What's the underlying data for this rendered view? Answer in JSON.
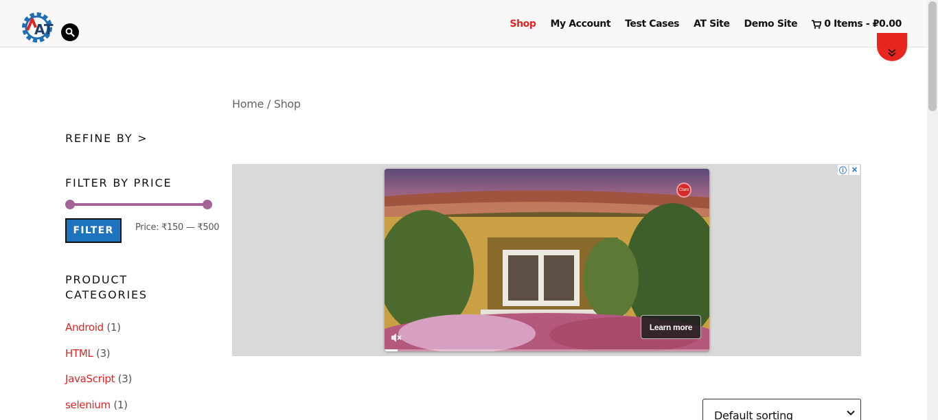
{
  "header": {
    "logo_alt": "AT",
    "nav": [
      {
        "label": "Shop",
        "active": true
      },
      {
        "label": "My Account",
        "active": false
      },
      {
        "label": "Test Cases",
        "active": false
      },
      {
        "label": "AT Site",
        "active": false
      },
      {
        "label": "Demo Site",
        "active": false
      }
    ],
    "cart_label": "0 Items - ₽0.00"
  },
  "breadcrumb": "Home / Shop",
  "sidebar": {
    "refine_title": "REFINE BY >",
    "price_title": "FILTER BY PRICE",
    "filter_button": "FILTER",
    "price_range": "Price: ₹150 — ₹500",
    "price_slider": {
      "min_fraction": 0.0,
      "max_fraction": 1.0
    },
    "categories_title": "PRODUCT CATEGORIES",
    "categories": [
      {
        "name": "Android",
        "count": "(1)"
      },
      {
        "name": "HTML",
        "count": "(3)"
      },
      {
        "name": "JavaScript",
        "count": "(3)"
      },
      {
        "name": "selenium",
        "count": "(1)"
      }
    ]
  },
  "ad": {
    "learn_more": "Learn more",
    "info_icon": "ⓘ",
    "close_icon": "✕",
    "badge": "Claro",
    "progress_fraction": 0.04
  },
  "sorting": {
    "selected": "Default sorting"
  },
  "colors": {
    "accent_red": "#e02424",
    "filter_blue": "#1e73be",
    "slider_purple": "#a46497"
  }
}
